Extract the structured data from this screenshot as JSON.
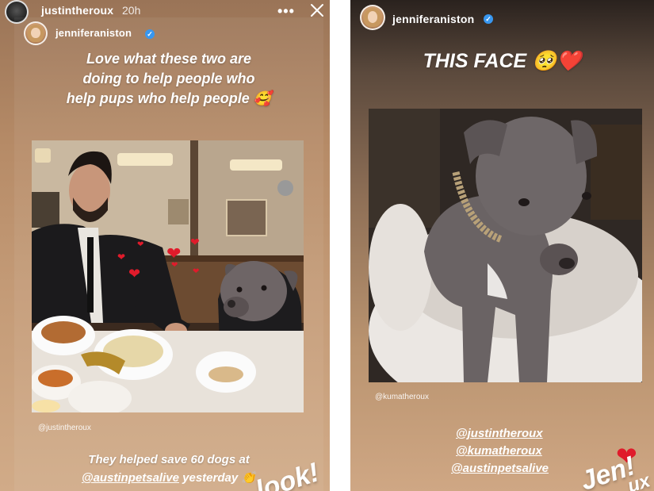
{
  "left_story": {
    "username": "justintheroux",
    "time": "20h",
    "reshared_username": "jenniferaniston",
    "caption": [
      "Love what these two are",
      "doing to help people who",
      "help pups who help people 🥰"
    ],
    "photo_credit": "@justintheroux",
    "footer_line1": "They helped save 60 dogs at",
    "footer_mention": "@austinpetsalive",
    "footer_rest": "yesterday 👏",
    "sticker": "look!",
    "icons": {
      "more": "more-horizontal-icon",
      "close": "close-icon"
    }
  },
  "right_story": {
    "username": "jenniferaniston",
    "caption": "THIS FACE 🥺❤️",
    "photo_credit": "@kumatheroux",
    "mentions": [
      "@justintheroux",
      "@kumatheroux",
      "@austinpetsalive"
    ],
    "sticker": "Jen!",
    "sticker_extra": "ux",
    "heart": "❤"
  },
  "colors": {
    "verified": "#3897f0",
    "heart": "#e01b2b"
  }
}
